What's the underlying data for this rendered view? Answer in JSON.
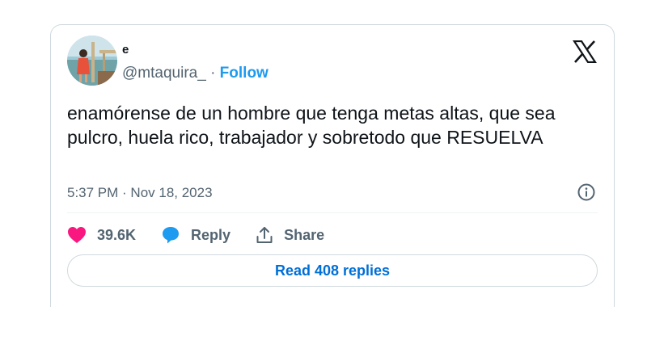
{
  "author": {
    "display_name": "e",
    "handle": "@mtaquira_",
    "separator": "·",
    "follow_label": "Follow"
  },
  "tweet": {
    "text": "enamórense de un hombre que tenga metas altas, que sea pulcro, huela rico, trabajador y sobretodo que RESUELVA",
    "timestamp": "5:37 PM · Nov 18, 2023"
  },
  "actions": {
    "likes": "39.6K",
    "reply_label": "Reply",
    "share_label": "Share"
  },
  "read_replies_label": "Read 408 replies",
  "colors": {
    "like": "#f91880",
    "reply": "#1d9bf0",
    "follow": "#1d9bf0",
    "link": "#006fd6",
    "muted": "#536471",
    "border": "#cfd9de"
  },
  "icons": [
    "x-logo-icon",
    "info-icon",
    "heart-icon",
    "reply-bubble-icon",
    "share-icon"
  ]
}
